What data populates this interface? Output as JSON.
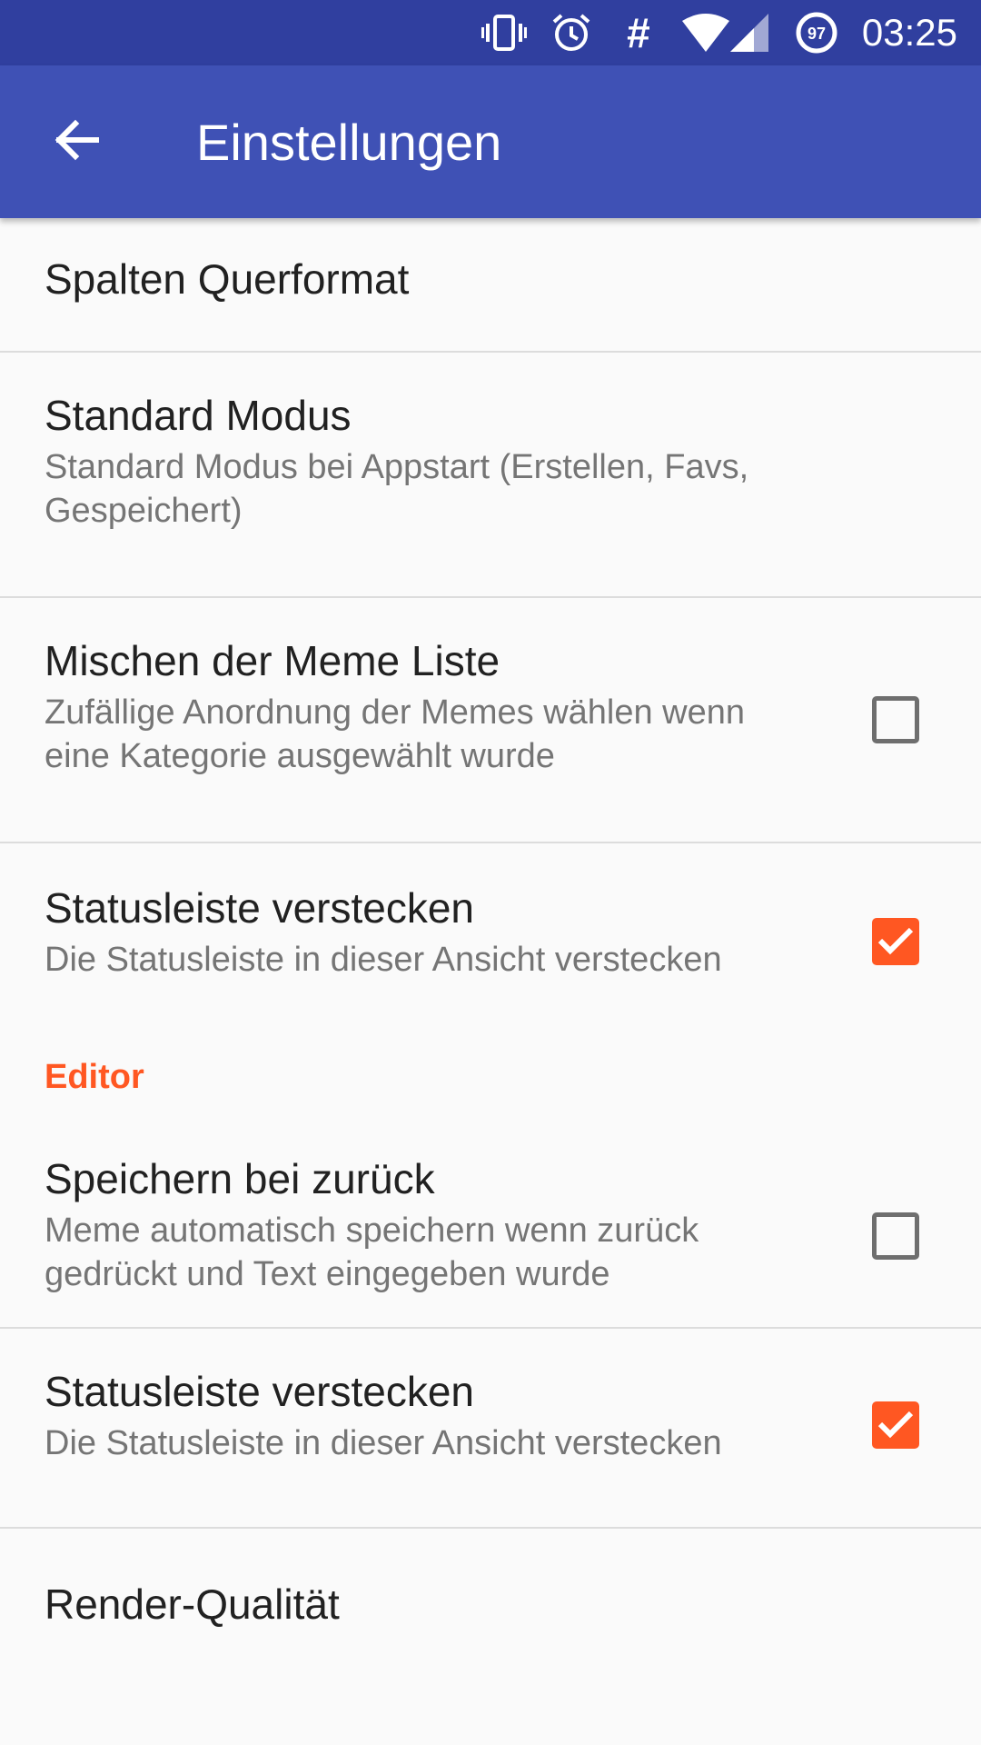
{
  "status_bar": {
    "icons": [
      "vibrate-icon",
      "alarm-icon",
      "hash-icon",
      "wifi-icon",
      "signal-icon",
      "battery-icon"
    ],
    "hash_glyph": "#",
    "battery_level": "97",
    "time": "03:25"
  },
  "app_bar": {
    "back_icon": "arrow-back-icon",
    "title": "Einstellungen",
    "color": "#3f51b5"
  },
  "accent_color": "#ff5722",
  "preferences": [
    {
      "title": "Spalten Querformat"
    },
    {
      "title": "Standard Modus",
      "summary": "Standard Modus bei Appstart (Erstellen, Favs, Gespeichert)"
    },
    {
      "title": "Mischen der Meme Liste",
      "summary": "Zufällige Anordnung der Memes wählen wenn eine Kategorie ausgewählt wurde",
      "checked": false
    },
    {
      "title": "Statusleiste verstecken",
      "summary": "Die Statusleiste in dieser Ansicht verstecken",
      "checked": true
    }
  ],
  "editor_section": {
    "header": "Editor",
    "items": [
      {
        "title": "Speichern bei zurück",
        "summary": "Meme automatisch speichern wenn zurück gedrückt und Text eingegeben wurde",
        "checked": false
      },
      {
        "title": "Statusleiste verstecken",
        "summary": "Die Statusleiste in dieser Ansicht verstecken",
        "checked": true
      },
      {
        "title": "Render-Qualität"
      }
    ]
  }
}
